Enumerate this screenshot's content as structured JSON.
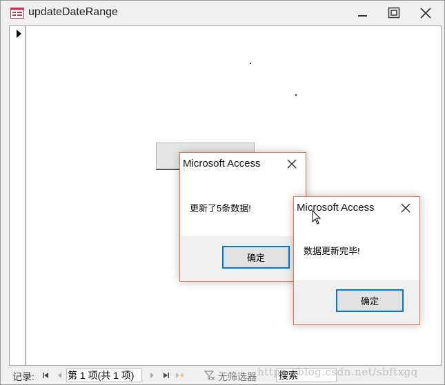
{
  "window": {
    "title": "updateDateRange",
    "icon": "form-icon"
  },
  "navbar": {
    "record_label": "记录:",
    "current_record": "第 1 项(共 1 项)",
    "filter_label": "无筛选器",
    "search_placeholder": "搜索"
  },
  "watermark": "https://blog.csdn.net/sbftxgq",
  "dialogs": [
    {
      "title": "Microsoft Access",
      "message": "更新了5条数据!",
      "ok_label": "确定"
    },
    {
      "title": "Microsoft Access",
      "message": "数据更新完毕!",
      "ok_label": "确定"
    }
  ],
  "colors": {
    "dialog_border": "#e0734a",
    "focus_border": "#0078d7",
    "app_icon": "#c2384e"
  }
}
